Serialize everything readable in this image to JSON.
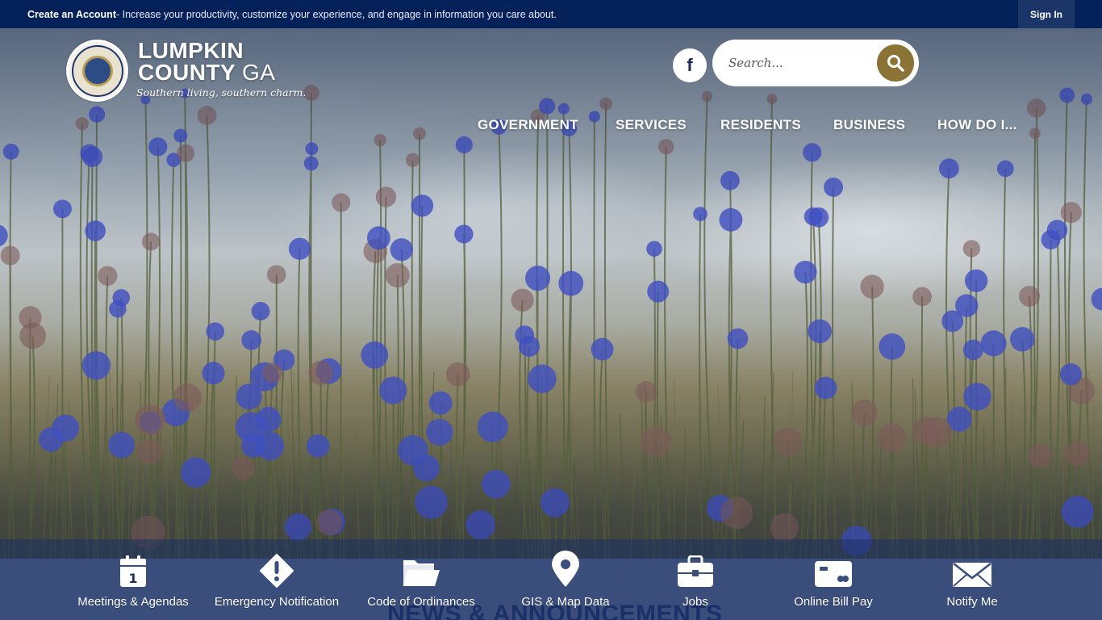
{
  "topbar": {
    "create_account": "Create an Account",
    "message": " - Increase your productivity, customize your experience, and engage in information you care about.",
    "sign_in": "Sign In"
  },
  "logo": {
    "line1": "LUMPKIN",
    "line2_bold": "COUNTY",
    "line2_light": "GA",
    "tagline": "Southern living, southern charm."
  },
  "social": {
    "facebook_glyph": "f",
    "icon": "facebook-icon"
  },
  "search": {
    "placeholder": "Search...",
    "icon": "search-icon"
  },
  "nav": {
    "items": [
      {
        "label": "GOVERNMENT"
      },
      {
        "label": "SERVICES"
      },
      {
        "label": "RESIDENTS"
      },
      {
        "label": "BUSINESS"
      },
      {
        "label": "HOW DO I..."
      }
    ]
  },
  "quick_links": [
    {
      "label": "Meetings & Agendas",
      "icon": "calendar-icon",
      "calendar_day": "1"
    },
    {
      "label": "Emergency Notification",
      "icon": "alert-diamond-icon"
    },
    {
      "label": "Code of Ordinances",
      "icon": "folder-icon"
    },
    {
      "label": "GIS & Map Data",
      "icon": "map-pin-icon"
    },
    {
      "label": "Jobs",
      "icon": "briefcase-icon"
    },
    {
      "label": "Online Bill Pay",
      "icon": "credit-card-icon"
    },
    {
      "label": "Notify Me",
      "icon": "envelope-icon"
    }
  ],
  "section_title_partial": "NEWS & ANNOUNCEMENTS",
  "colors": {
    "topbar": "#05215a",
    "accent_gold": "#8b7235",
    "quickbar": "#3a4e7e",
    "nav_text": "#ffffff"
  }
}
